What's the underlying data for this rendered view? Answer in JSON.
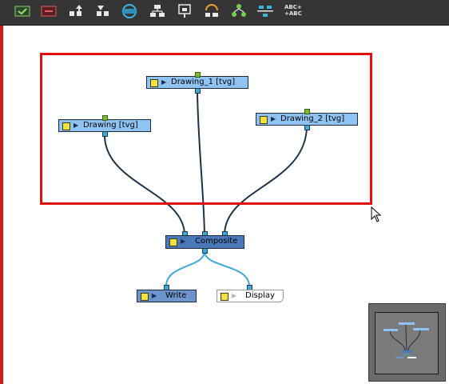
{
  "toolbar": {
    "tools": [
      {
        "icon": "enable-checkmark-icon"
      },
      {
        "icon": "disable-node-icon"
      },
      {
        "icon": "move-up-network-icon"
      },
      {
        "icon": "move-down-network-icon"
      },
      {
        "icon": "peg-link-icon"
      },
      {
        "icon": "group-nodes-icon"
      },
      {
        "icon": "display-node-icon"
      },
      {
        "icon": "node-library-icon"
      },
      {
        "icon": "node-tree-icon"
      },
      {
        "icon": "align-nodes-icon"
      },
      {
        "icon": "rename-nodes-icon",
        "text_line1": "ABC+",
        "text_line2": "+ABC"
      }
    ]
  },
  "nodes": {
    "drawing_1": {
      "label": "Drawing_1  [tvg]"
    },
    "drawing": {
      "label": "Drawing  [tvg]"
    },
    "drawing_2": {
      "label": "Drawing_2  [tvg]"
    },
    "composite": {
      "label": "Composite"
    },
    "write": {
      "label": "Write"
    },
    "display": {
      "label": "Display"
    }
  },
  "colors": {
    "selection": "#e01010",
    "node_fill": "#8fc3f2",
    "composite_fill": "#4a78b8",
    "write_fill": "#6d95cc",
    "wire_dark": "#1f3347",
    "wire_light": "#3da9d6",
    "toolbar_bg": "#353535"
  }
}
